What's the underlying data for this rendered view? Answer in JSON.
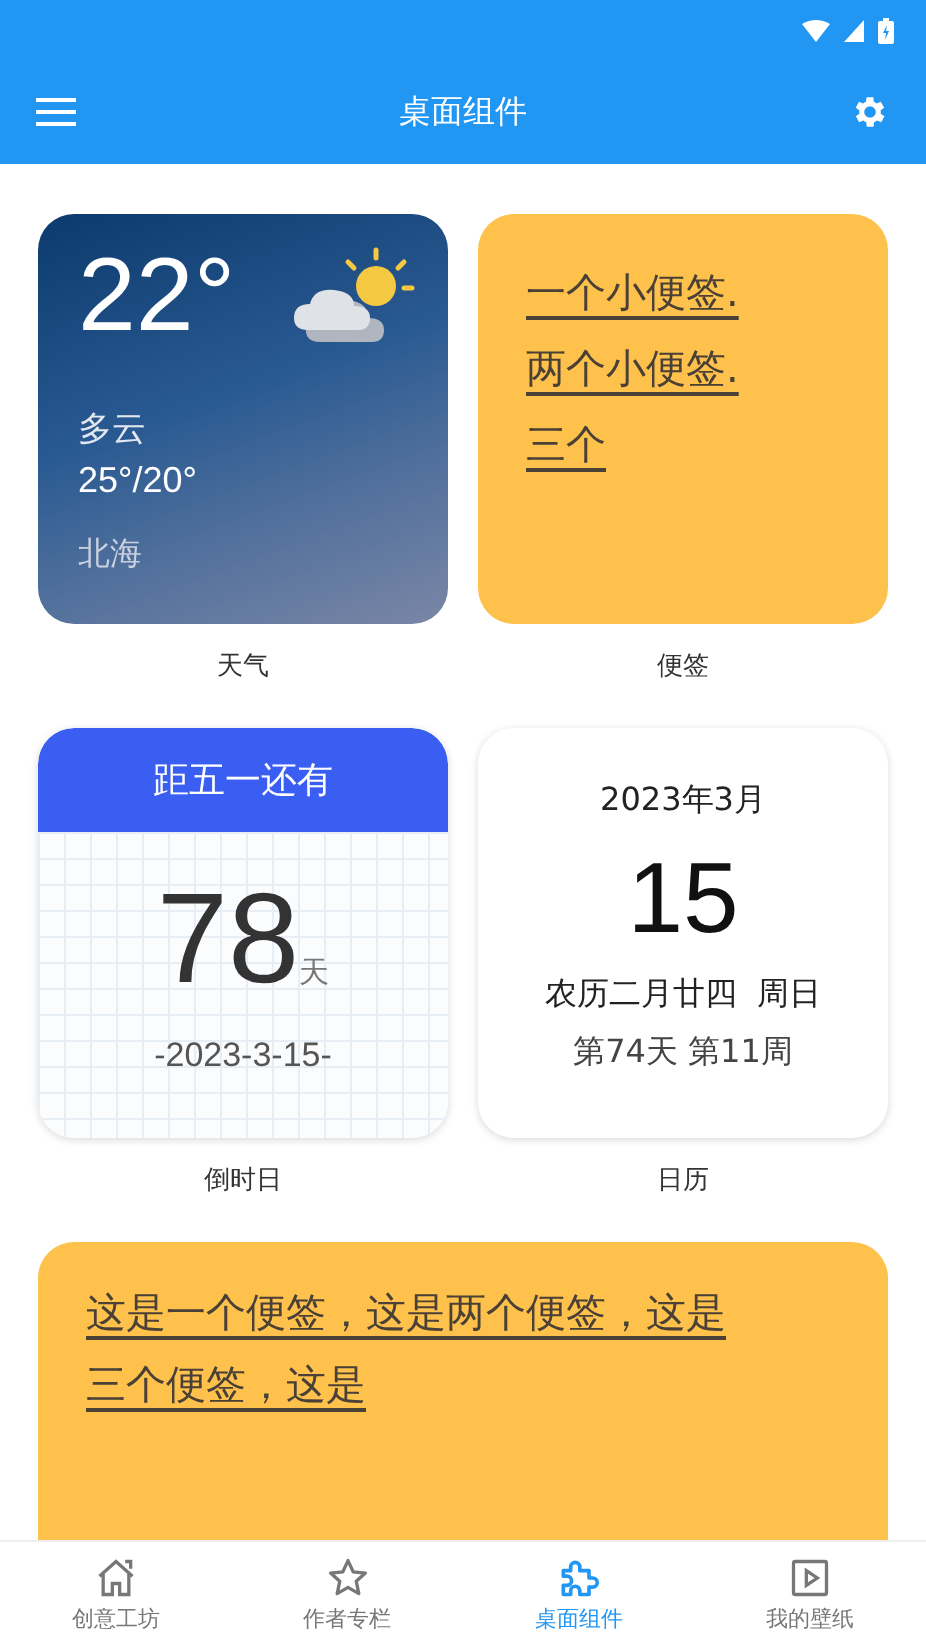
{
  "app_bar": {
    "title": "桌面组件"
  },
  "widgets": [
    {
      "kind": "weather",
      "label": "天气",
      "temperature": "22°",
      "condition": "多云",
      "range": "25°/20°",
      "city": "北海"
    },
    {
      "kind": "note",
      "label": "便签",
      "lines": [
        "一个小便签.",
        "两个小便签.",
        "三个"
      ]
    },
    {
      "kind": "countdown",
      "label": "倒时日",
      "header": "距五一还有",
      "days": "78",
      "unit": "天",
      "date": "-2023-3-15-"
    },
    {
      "kind": "calendar",
      "label": "日历",
      "month": "2023年3月",
      "day": "15",
      "lunar": "农历二月廿四  周日",
      "stats": "第74天 第11周"
    }
  ],
  "wide_note": {
    "lines": [
      "这是一个便签，这是两个便签，这是",
      "三个便签，这是"
    ]
  },
  "bottom_nav": [
    {
      "label": "创意工坊",
      "selected": false
    },
    {
      "label": "作者专栏",
      "selected": false
    },
    {
      "label": "桌面组件",
      "selected": true
    },
    {
      "label": "我的壁纸",
      "selected": false
    }
  ]
}
